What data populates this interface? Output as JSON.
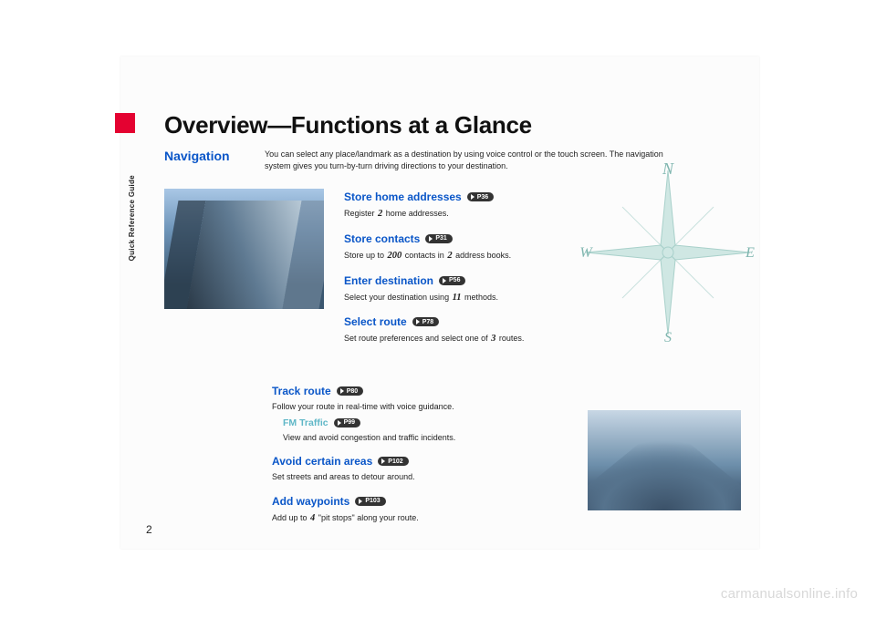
{
  "sideLabel": "Quick Reference Guide",
  "pageNumber": "2",
  "title": "Overview—Functions at a Glance",
  "navLabel": "Navigation",
  "introText": "You can select any place/landmark as a destination by using voice control or the touch screen. The navigation system gives you turn-by-turn driving directions to your destination.",
  "featuresA": [
    {
      "title": "Store home addresses",
      "ref": "P36",
      "descPre": "Register ",
      "num": "2",
      "descPost": " home addresses."
    },
    {
      "title": "Store contacts",
      "ref": "P31",
      "descPre": "Store up to ",
      "num": "200",
      "descMid": " contacts in ",
      "num2": "2",
      "descPost": " address books."
    },
    {
      "title": "Enter destination",
      "ref": "P56",
      "descPre": "Select your destination using ",
      "num": "11",
      "descPost": " methods."
    },
    {
      "title": "Select route",
      "ref": "P78",
      "descPre": "Set route preferences and select one of ",
      "num": "3",
      "descPost": " routes."
    }
  ],
  "featuresB": [
    {
      "title": "Track route",
      "ref": "P80",
      "desc": "Follow your route in real-time with voice guidance.",
      "sub": {
        "title": "FM Traffic",
        "ref": "P99",
        "desc": "View and avoid congestion and traffic incidents."
      }
    },
    {
      "title": "Avoid certain areas",
      "ref": "P102",
      "desc": "Set streets and areas to detour around."
    },
    {
      "title": "Add waypoints",
      "ref": "P103",
      "descPre": "Add up to ",
      "num": "4",
      "descPost": " \"pit stops\" along your route."
    }
  ],
  "compass": {
    "n": "N",
    "e": "E",
    "s": "S",
    "w": "W"
  },
  "watermark": "carmanualsonline.info"
}
